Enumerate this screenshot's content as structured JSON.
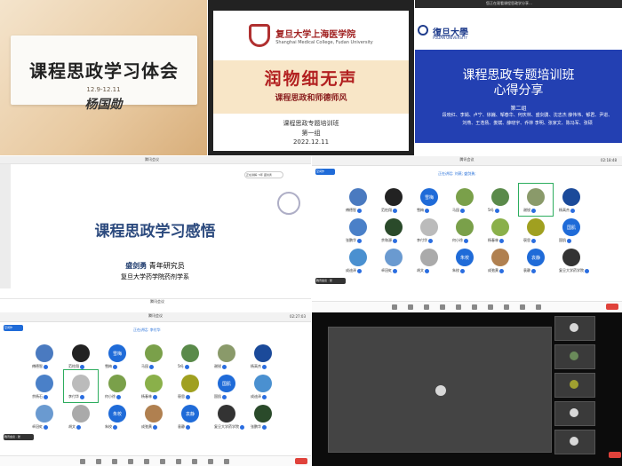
{
  "tile1": {
    "title": "课程思政学习体会",
    "date": "12.9-12.11",
    "signature": "杨国勋"
  },
  "tile2": {
    "school_cn": "复旦大学上海医学院",
    "school_en": "Shanghai Medical College, Fudan University",
    "headline": "润物细无声",
    "subhead": "课程思政和师德师风",
    "line1": "课程思政专题培训班",
    "line2": "第一组",
    "line3": "2022.12.11"
  },
  "tile3": {
    "window_title": "您正在观看课程思政学分享…",
    "brand_cn": "復旦大學",
    "brand_en": "FUDAN UNIVERSITY",
    "title_line1": "课程思政专题培训班",
    "title_line2": "心得分享",
    "group": "第二组",
    "names": "段晓红、李娟、卢宁、徐巍、邹春华、何庆林、盛剑勇、沈志杰 薛伟伟、郁君、尹进、刘燕、王浩扬、娄斌、薛晓宇、乔林 李明、张家文、陈冯军、张硕"
  },
  "tile4": {
    "window_title": "腾讯会议",
    "share_pill": "正在讲解: 5年 盛剑勇",
    "title": "课程思政学习感悟",
    "presenter": "盛剑勇",
    "presenter_role": "青年研究员",
    "affiliation": "复旦大学药学院药剂学系",
    "footer": "腾讯会议"
  },
  "gallery1": {
    "window_title": "腾讯会议",
    "speaking": "正在讲话: 刘燕; 盛剑勇;",
    "time": "02:18:48",
    "tab": "空间作",
    "me": "腾讯会议 · 张",
    "participants": [
      {
        "name": "傅德智",
        "color": "#4a7ac0"
      },
      {
        "name": "范柱翔",
        "color": "#222"
      },
      {
        "name": "雪梅",
        "color": "#1f6bd8",
        "text": "雪梅"
      },
      {
        "name": "马园",
        "color": "#7aa04a"
      },
      {
        "name": "5吗",
        "color": "#5a8a4a"
      },
      {
        "name": "谢锐",
        "color": "#8a9a6a"
      },
      {
        "name": "杨高杰",
        "color": "#1b4a9a"
      },
      {
        "name": "张鹏华",
        "color": "#4a80c8"
      },
      {
        "name": "余和源",
        "color": "#2a4a2a"
      },
      {
        "name": "李付华",
        "color": "#bbb"
      },
      {
        "name": "何小徐",
        "color": "#7aa04a"
      },
      {
        "name": "杨春林",
        "color": "#8ab04a"
      },
      {
        "name": "褒思",
        "color": "#a0a020"
      },
      {
        "name": "国肌",
        "color": "#1f6bd8",
        "text": "国肌"
      },
      {
        "name": "成迪泽",
        "color": "#4a90d0"
      },
      {
        "name": "卓冠虹",
        "color": "#6a9ad0"
      },
      {
        "name": "胡文",
        "color": "#aaa"
      },
      {
        "name": "朱校",
        "color": "#1f6bd8",
        "text": "朱校"
      },
      {
        "name": "成弛黄",
        "color": "#b08050"
      },
      {
        "name": "袁静",
        "color": "#1f6bd8",
        "text": "袁静"
      },
      {
        "name": "复旦大学药学院",
        "color": "#333"
      }
    ]
  },
  "gallery2": {
    "window_title": "腾讯会议",
    "speaking": "正在讲话: 李付华",
    "time": "02:27:03",
    "tab": "空间作",
    "me": "腾讯会议 · 张",
    "participants": [
      {
        "name": "傅德智",
        "color": "#4a7ac0"
      },
      {
        "name": "范柱翔",
        "color": "#222"
      },
      {
        "name": "雪梅",
        "color": "#1f6bd8",
        "text": "雪梅"
      },
      {
        "name": "马园",
        "color": "#7aa04a"
      },
      {
        "name": "5吗",
        "color": "#5a8a4a"
      },
      {
        "name": "谢锐",
        "color": "#8a9a6a"
      },
      {
        "name": "杨高杰",
        "color": "#1b4a9a"
      },
      {
        "name": "余杨石",
        "color": "#4a80c8"
      },
      {
        "name": "李付华",
        "color": "#bbb"
      },
      {
        "name": "何小徐",
        "color": "#7aa04a"
      },
      {
        "name": "杨春林",
        "color": "#8ab04a"
      },
      {
        "name": "褒思",
        "color": "#a0a020"
      },
      {
        "name": "国肌",
        "color": "#1f6bd8",
        "text": "国肌"
      },
      {
        "name": "成迪泽",
        "color": "#4a90d0"
      },
      {
        "name": "卓冠虹",
        "color": "#6a9ad0"
      },
      {
        "name": "胡文",
        "color": "#aaa"
      },
      {
        "name": "朱校",
        "color": "#1f6bd8",
        "text": "朱校"
      },
      {
        "name": "成弛黄",
        "color": "#b08050"
      },
      {
        "name": "袁静",
        "color": "#1f6bd8",
        "text": "袁静"
      },
      {
        "name": "复旦大学药学院",
        "color": "#333"
      },
      {
        "name": "张鹏华",
        "color": "#2a4a2a"
      }
    ]
  }
}
